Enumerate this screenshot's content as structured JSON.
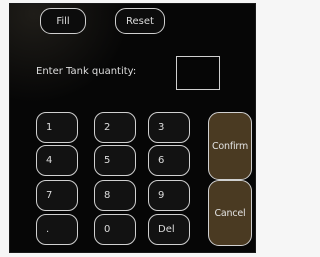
{
  "header": {
    "fill_label": "Fill",
    "reset_label": "Reset"
  },
  "entry": {
    "prompt": "Enter Tank quantity:",
    "value": ""
  },
  "keypad": {
    "keys": [
      "1",
      "2",
      "3",
      "4",
      "5",
      "6",
      "7",
      "8",
      "9",
      ".",
      "0",
      "Del"
    ],
    "confirm_label": "Confirm",
    "cancel_label": "Cancel"
  },
  "colors": {
    "screen_bg": "#060606",
    "outline": "#d0d0d0",
    "text": "#dcdcdc",
    "side_button_fill": "#4a3a22"
  }
}
